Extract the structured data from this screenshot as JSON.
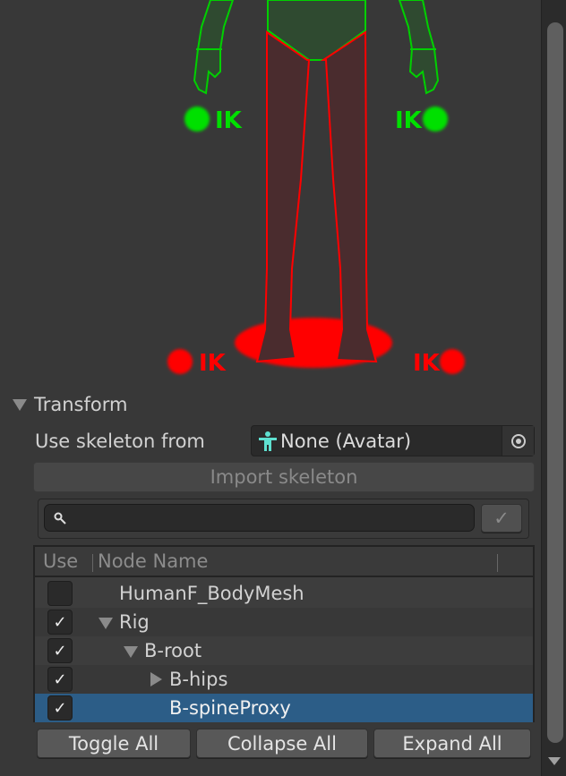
{
  "figure": {
    "ik_label": "IK",
    "colors": {
      "enabled": "#00e000",
      "disabled": "#ff0000"
    }
  },
  "transform": {
    "section_title": "Transform",
    "use_skeleton_label": "Use skeleton from",
    "avatar_field_value": "None (Avatar)",
    "import_button": "Import skeleton",
    "search_placeholder": "",
    "table": {
      "headers": {
        "use": "Use",
        "node_name": "Node Name"
      },
      "rows": [
        {
          "name": "HumanF_BodyMesh",
          "checked": false,
          "expander": "none",
          "depth": 0
        },
        {
          "name": "Rig",
          "checked": true,
          "expander": "expanded",
          "depth": 0
        },
        {
          "name": "B-root",
          "checked": true,
          "expander": "expanded",
          "depth": 1
        },
        {
          "name": "B-hips",
          "checked": true,
          "expander": "collapsed",
          "depth": 2
        },
        {
          "name": "B-spineProxy",
          "checked": true,
          "expander": "none",
          "depth": 2,
          "selected": true
        }
      ],
      "check_glyph": "✓"
    },
    "buttons": {
      "toggle_all": "Toggle All",
      "collapse_all": "Collapse All",
      "expand_all": "Expand All"
    }
  }
}
